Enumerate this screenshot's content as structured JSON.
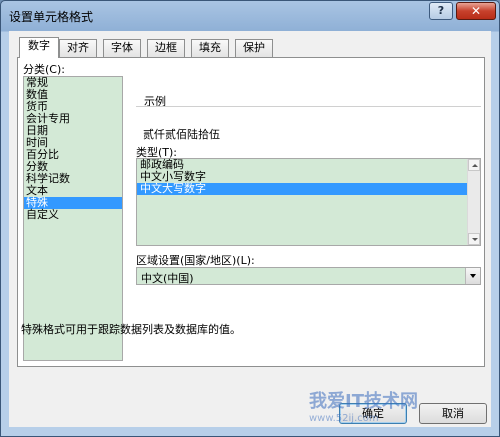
{
  "window": {
    "title": "设置单元格格式",
    "help_label": "?",
    "close_label": "✕"
  },
  "tabs": [
    {
      "label": "数字",
      "active": true
    },
    {
      "label": "对齐",
      "active": false
    },
    {
      "label": "字体",
      "active": false
    },
    {
      "label": "边框",
      "active": false
    },
    {
      "label": "填充",
      "active": false
    },
    {
      "label": "保护",
      "active": false
    }
  ],
  "category": {
    "label": "分类(C):",
    "items": [
      "常规",
      "数值",
      "货币",
      "会计专用",
      "日期",
      "时间",
      "百分比",
      "分数",
      "科学记数",
      "文本",
      "特殊",
      "自定义"
    ],
    "selected": "特殊"
  },
  "sample": {
    "label": "示例",
    "value": "贰仟贰佰陆拾伍"
  },
  "type": {
    "label": "类型(T):",
    "items": [
      "邮政编码",
      "中文小写数字",
      "中文大写数字"
    ],
    "selected": "中文大写数字"
  },
  "locale": {
    "label": "区域设置(国家/地区)(L):",
    "value": "中文(中国)"
  },
  "description": "特殊格式可用于跟踪数据列表及数据库的值。",
  "buttons": {
    "ok": "确定",
    "cancel": "取消"
  },
  "watermark": {
    "text": "我爱IT技术网",
    "sub": "www.52ij.com"
  }
}
